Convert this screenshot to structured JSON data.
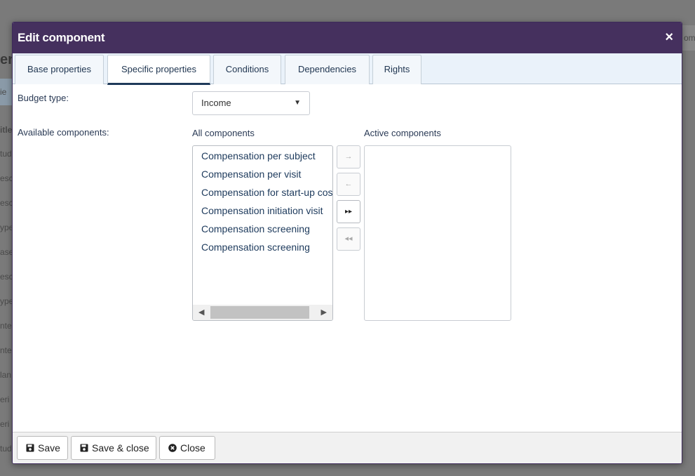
{
  "background": {
    "fragments": [
      "om",
      "en",
      "ie",
      "itle",
      "tud",
      "esc",
      "esc",
      "ype",
      "ase",
      "esc",
      "ype",
      "nte",
      "nte",
      "lan",
      "eri",
      "eri",
      "tud"
    ]
  },
  "dialog": {
    "title": "Edit component",
    "close_symbol": "×",
    "tabs": [
      {
        "label": "Base properties"
      },
      {
        "label": "Specific properties"
      },
      {
        "label": "Conditions"
      },
      {
        "label": "Dependencies"
      },
      {
        "label": "Rights"
      }
    ],
    "active_tab": "Specific properties",
    "budget_type": {
      "label": "Budget type:",
      "value": "Income"
    },
    "available_components": {
      "label": "Available components:",
      "all_header": "All components",
      "active_header": "Active components",
      "all_items": [
        "Compensation per subject",
        "Compensation per visit",
        "Compensation for start-up costs",
        "Compensation initiation visit",
        "Compensation screening",
        "Compensation screening"
      ],
      "active_items": [],
      "move_buttons": {
        "add": "→",
        "remove": "←",
        "add_all": "▸▸",
        "remove_all": "◂◂"
      }
    },
    "footer": {
      "save_label": "Save",
      "save_close_label": "Save & close",
      "close_label": "Close"
    }
  },
  "colors": {
    "titlebar": "#45305e",
    "tab_active_underline": "#1f3a5a",
    "text_primary": "#1d3a5c"
  }
}
